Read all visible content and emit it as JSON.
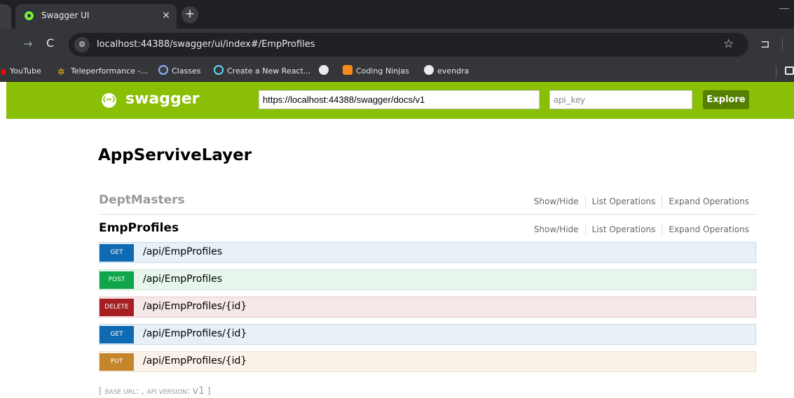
{
  "browser": {
    "tab_title": "Swagger UI",
    "tab_close": "×",
    "new_tab": "+",
    "url": "localhost:44388/swagger/ui/index#/EmpProfiles",
    "icons": {
      "forward": "→",
      "reload": "C",
      "star": "☆",
      "extensions": "⊐"
    },
    "bookmarks": [
      {
        "label": "YouTube",
        "icon": "youtube-icon"
      },
      {
        "label": "Teleperformance -...",
        "icon": "teleperformance-icon"
      },
      {
        "label": "Classes",
        "icon": "classes-icon"
      },
      {
        "label": "Create a New React...",
        "icon": "react-icon"
      },
      {
        "label": "",
        "icon": "globe-icon"
      },
      {
        "label": "Coding Ninjas",
        "icon": "coding-ninjas-icon"
      },
      {
        "label": "evendra",
        "icon": "globe-icon"
      }
    ]
  },
  "swagger": {
    "logo_text": "swagger",
    "logo_glyph": "{↔}",
    "url_value": "https://localhost:44388/swagger/docs/v1",
    "api_key_placeholder": "api_key",
    "explore_label": "Explore",
    "brand_color": "#89bf04"
  },
  "app_title": "AppServiveLayer",
  "resources": [
    {
      "name": "DeptMasters",
      "show_hide": "Show/Hide",
      "list_ops": "List Operations",
      "expand_ops": "Expand Operations"
    },
    {
      "name": "EmpProfiles",
      "show_hide": "Show/Hide",
      "list_ops": "List Operations",
      "expand_ops": "Expand Operations"
    }
  ],
  "operations": [
    {
      "method": "GET",
      "path": "/api/EmpProfiles",
      "color": "#0f6ab4"
    },
    {
      "method": "POST",
      "path": "/api/EmpProfiles",
      "color": "#10a54a"
    },
    {
      "method": "DELETE",
      "path": "/api/EmpProfiles/{id}",
      "color": "#a41e22"
    },
    {
      "method": "GET",
      "path": "/api/EmpProfiles/{id}",
      "color": "#0f6ab4"
    },
    {
      "method": "PUT",
      "path": "/api/EmpProfiles/{id}",
      "color": "#c5862b"
    }
  ],
  "footer": {
    "open": "[",
    "base_url_label": "BASE URL",
    "sep1": ": , ",
    "api_version_label": "API VERSION",
    "sep2": ": ",
    "version": "v1",
    "close": "]"
  }
}
